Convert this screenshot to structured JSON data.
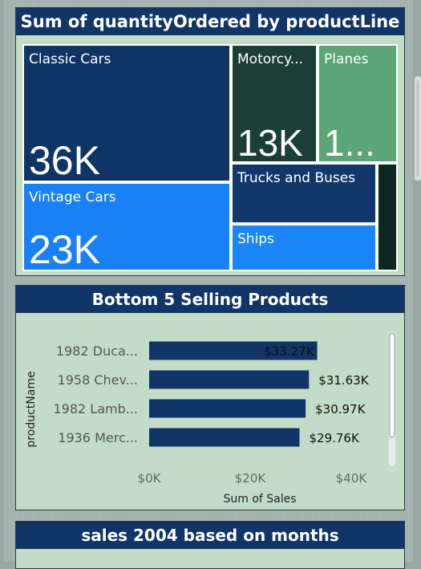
{
  "treemap": {
    "title": "Sum of quantityOrdered by productLine",
    "tiles": [
      {
        "label": "Classic Cars",
        "value": "36K",
        "color": "#0f3567"
      },
      {
        "label": "Vintage Cars",
        "value": "23K",
        "color": "#1a80f5"
      },
      {
        "label": "Motorcy...",
        "value": "13K",
        "color": "#1b3f36"
      },
      {
        "label": "Planes",
        "value": "1...",
        "color": "#5aa676"
      },
      {
        "label": "Trucks and Buses",
        "value": "",
        "color": "#12386b"
      },
      {
        "label": "Ships",
        "value": "",
        "color": "#1a86f7"
      },
      {
        "label": "",
        "value": "",
        "color": "#0e2620"
      }
    ]
  },
  "chart_data": {
    "type": "bar",
    "orientation": "horizontal",
    "title": "Bottom 5 Selling Products",
    "xlabel": "Sum of Sales",
    "ylabel": "productName",
    "categories": [
      "1982 Duca...",
      "1958 Chev...",
      "1982 Lamb...",
      "1936 Merc..."
    ],
    "values": [
      33270,
      31630,
      30970,
      29760
    ],
    "data_labels": [
      "$33.27K",
      "$31.63K",
      "$30.97K",
      "$29.76K"
    ],
    "xlim": [
      0,
      40000
    ],
    "xticks": [
      0,
      20000,
      40000
    ],
    "xtick_labels": [
      "$0K",
      "$20K",
      "$40K"
    ],
    "bar_color": "#113567",
    "grid": false
  },
  "bottom_card": {
    "title": "sales 2004 based on months"
  }
}
